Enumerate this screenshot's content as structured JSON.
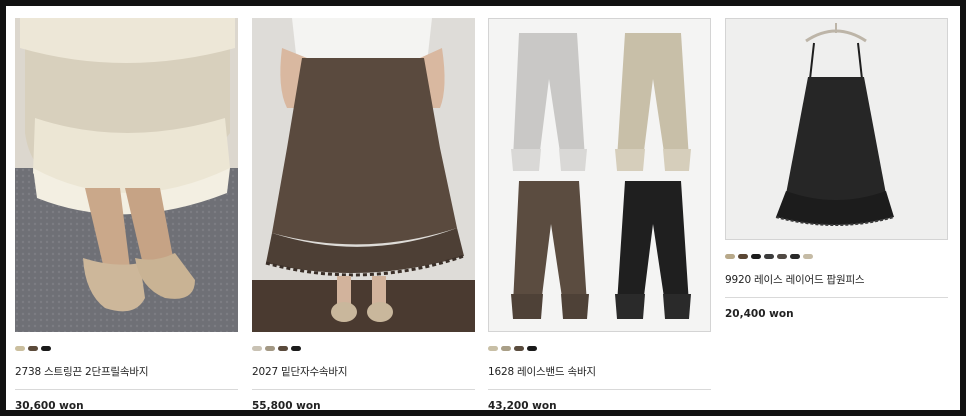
{
  "products": [
    {
      "name": "2738 스트링끈 2단프릴속바지",
      "price": "30,600 won",
      "swatches": [
        "#cbbf9f",
        "#5b4a3a",
        "#1a1a1a"
      ]
    },
    {
      "name": "2027 밑단자수속바지",
      "price": "55,800 won",
      "swatches": [
        "#c9c2b4",
        "#a39884",
        "#5a4a3c",
        "#1b1b1b"
      ]
    },
    {
      "name": "1628 레이스밴드 속바지",
      "price": "43,200 won",
      "swatches": [
        "#c8bfa6",
        "#a99f87",
        "#5a4c3e",
        "#1a1a1a"
      ]
    },
    {
      "name": "9920 레이스 레이어드 팝원피스",
      "price": "20,400 won",
      "swatches": [
        "#b8a98a",
        "#5a4634",
        "#1c1c1c",
        "#3c3c3c",
        "#514a44",
        "#2a2a2a",
        "#c5bba5"
      ]
    }
  ]
}
